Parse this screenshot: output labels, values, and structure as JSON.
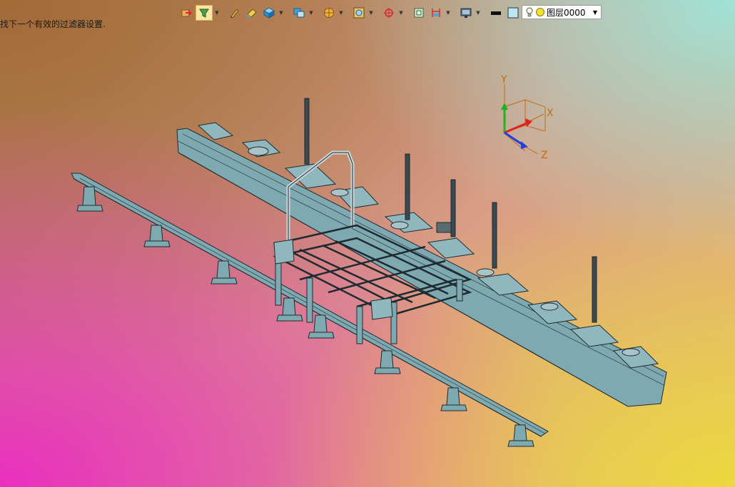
{
  "status": {
    "message": "找下一个有效的过滤器设置."
  },
  "toolbar": {
    "buttons": [
      {
        "icon": "exit-sketch-icon"
      },
      {
        "icon": "select-filter-icon",
        "active": true,
        "dropdown": true
      },
      {
        "icon": "pencil-icon"
      },
      {
        "icon": "eraser-icon"
      },
      {
        "icon": "cube-icon",
        "dropdown": true
      },
      {
        "icon": "view-orient-icon",
        "dropdown": true
      },
      {
        "icon": "render-sphere-icon",
        "dropdown": true
      },
      {
        "icon": "zoom-fit-icon",
        "dropdown": true
      },
      {
        "icon": "rotate-origin-icon",
        "dropdown": true
      },
      {
        "icon": "sheet-icon"
      },
      {
        "icon": "dimension-icon",
        "dropdown": true
      },
      {
        "icon": "display-monitor-icon",
        "dropdown": true
      },
      {
        "icon": "line-color-icon"
      },
      {
        "icon": "fill-color-icon"
      },
      {
        "icon": "layer-stack-icon",
        "dropdown": true
      }
    ]
  },
  "layer": {
    "name": "图层0000"
  },
  "triad": {
    "x_label": "X",
    "y_label": "Y",
    "z_label": "Z"
  },
  "colors": {
    "model_fill": "#7fa9b0",
    "model_edge": "#1d2b30",
    "axis_x": "#e02020",
    "axis_y": "#1fb31f",
    "axis_z": "#1f3fe0",
    "triad_label": "#c46a12"
  }
}
